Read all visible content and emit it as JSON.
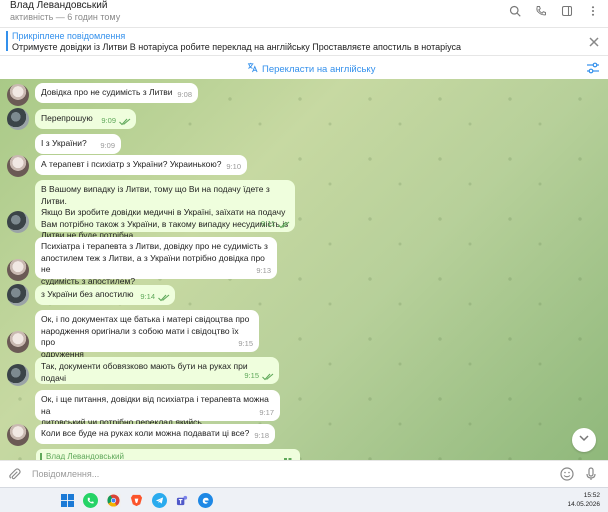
{
  "header": {
    "name": "Влад Левандовський",
    "status": "активність — 6 годин тому"
  },
  "pinned": {
    "title": "Прикріплене повідомлення",
    "text": "Отримуєте довідки із Литви В нотаріуса робите переклад на англійську  Проставляєте апостиль в нотаріуса"
  },
  "translate": {
    "label": "Перекласти на англійську"
  },
  "messages": [
    {
      "text": "Довідка про не судимість з Литви",
      "time": "9:08"
    },
    {
      "text": "Перепрошую",
      "time": "9:09"
    },
    {
      "text": "І з України?",
      "time": "9:09"
    },
    {
      "text": "А терапевт і психіатр з України? Украинькою?",
      "time": "9:10"
    },
    {
      "lines": [
        "В Вашому випадку із Литви, тому що Ви на подачу їдете з Литви.",
        "Якщо Ви зробите довідки медичні в Україні, заїхати на подачу",
        "Вам потрібно також з України, в такому випадку несудимість із",
        "Литви не буде потрібна"
      ],
      "time": "9:11"
    },
    {
      "lines": [
        "Психіатра і терапевта з Литви, довідку про не судимість з",
        "апостилем теж з Литви, а з України потрібно довідка про не",
        "судимість з апостилем?"
      ],
      "time": "9:13"
    },
    {
      "text": "з України без апостилю",
      "time": "9:14"
    },
    {
      "lines": [
        "Ок, і по документах ще батька і матері свідоцтва про",
        "народження оригінали з собою мати і свідоцтво їх про",
        "одруження"
      ],
      "time": "9:15"
    },
    {
      "text": "Так, документи обовязково мають бути на руках при подачі",
      "time": "9:15"
    },
    {
      "lines": [
        "Ок, і ще питання, довідки від психіатра і терапевта можна на",
        "литовський чи потрібно переклад якийсь"
      ],
      "time": "9:17"
    },
    {
      "text": "Коли все буде на руках коли можна подавати ці все?",
      "time": "9:18"
    }
  ],
  "reply_peek": {
    "name": "Влад Левандовський"
  },
  "composer": {
    "placeholder": "Повідомлення..."
  },
  "taskbar": {
    "time": "15:52",
    "date": "14.05.2026"
  },
  "colors": {
    "accent": "#3390ec",
    "outgoing_bubble": "#effedd",
    "read_ticks": "#5fa85a"
  }
}
